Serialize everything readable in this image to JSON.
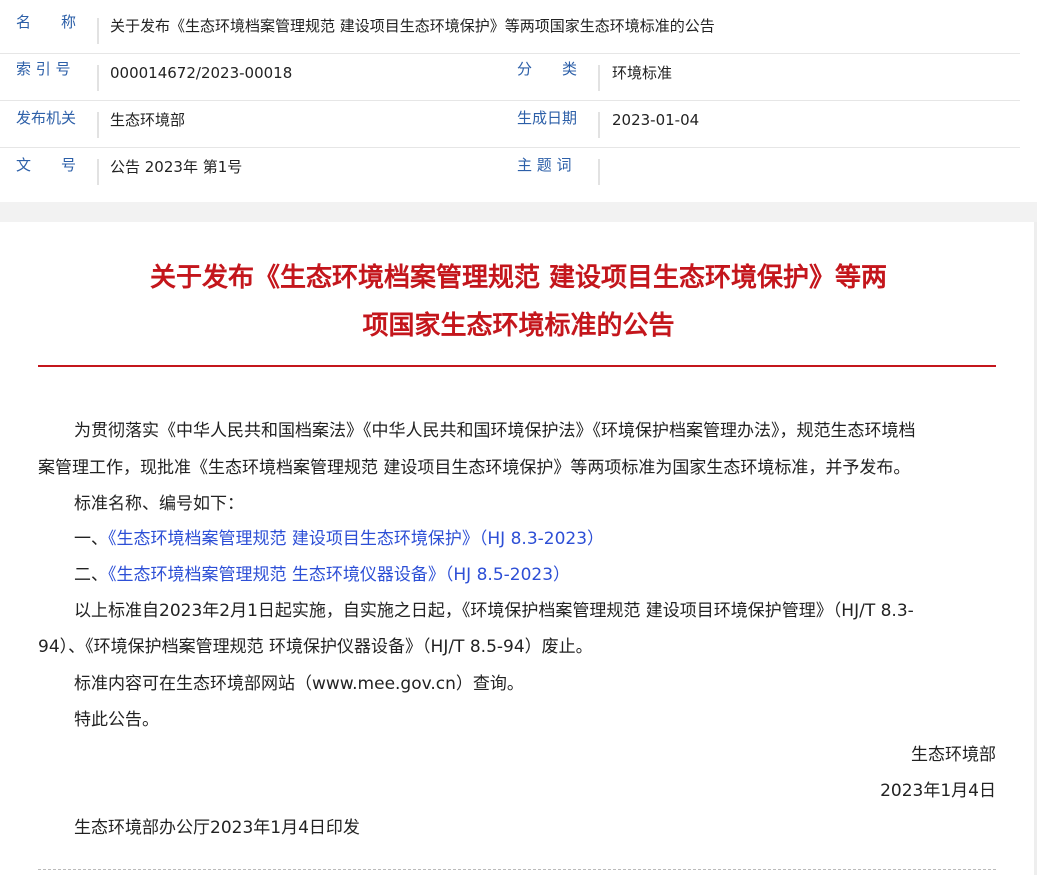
{
  "meta": {
    "name_label": "名　　称",
    "name_value": "关于发布《生态环境档案管理规范 建设项目生态环境保护》等两项国家生态环境标准的公告",
    "index_label": "索 引 号",
    "index_value": "000014672/2023-00018",
    "category_label": "分　　类",
    "category_value": "环境标准",
    "issuer_label": "发布机关",
    "issuer_value": "生态环境部",
    "date_label": "生成日期",
    "date_value": "2023-01-04",
    "docno_label": "文　　号",
    "docno_value": "公告 2023年 第1号",
    "subject_label": "主 题 词",
    "subject_value": ""
  },
  "article": {
    "title_line1": "关于发布《生态环境档案管理规范 建设项目生态环境保护》等两",
    "title_line2": "项国家生态环境标准的公告",
    "para1_line1": "为贯彻落实《中华人民共和国档案法》《中华人民共和国环境保护法》《环境保护档案管理办法》，规范生态环境档",
    "para1_line2": "案管理工作，现批准《生态环境档案管理规范 建设项目生态环境保护》等两项标准为国家生态环境标准，并予发布。",
    "para2": "标准名称、编号如下：",
    "item1_prefix": "一、",
    "item1_link": "《生态环境档案管理规范 建设项目生态环境保护》（HJ 8.3-2023）",
    "item2_prefix": "二、",
    "item2_link": "《生态环境档案管理规范 生态环境仪器设备》（HJ 8.5-2023）",
    "para3_line1": "以上标准自2023年2月1日起实施，自实施之日起，《环境保护档案管理规范 建设项目环境保护管理》（HJ/T 8.3-",
    "para3_line2": "94）、《环境保护档案管理规范 环境保护仪器设备》（HJ/T 8.5-94）废止。",
    "para4": "标准内容可在生态环境部网站（www.mee.gov.cn）查询。",
    "para5": "特此公告。",
    "signature": "生态环境部",
    "sign_date": "2023年1月4日",
    "footer_note": "生态环境部办公厅2023年1月4日印发"
  },
  "colors": {
    "label_blue": "#2c5fa8",
    "title_red": "#c4161c",
    "link_blue": "#2d4fd6"
  }
}
